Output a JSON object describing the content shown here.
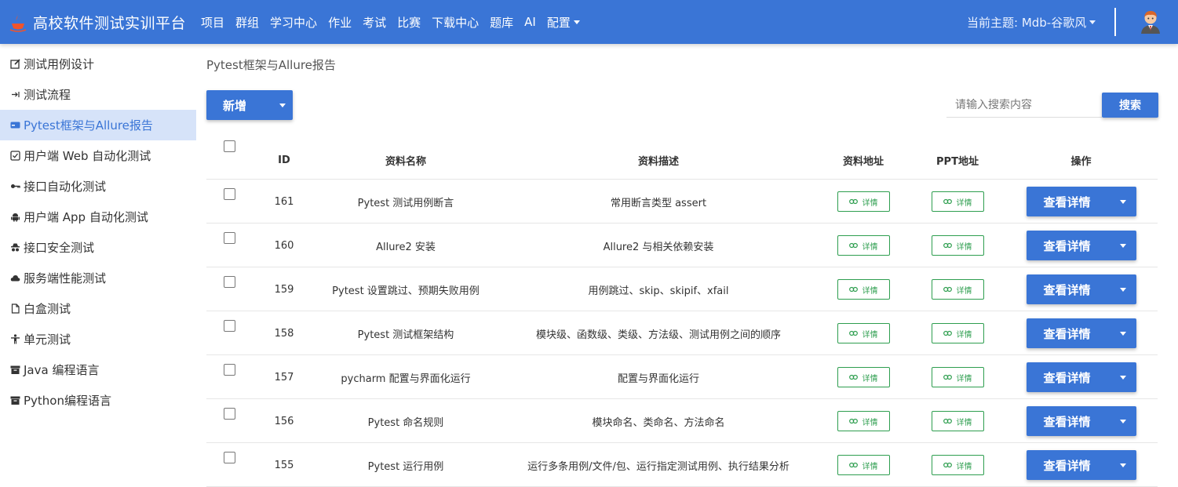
{
  "navbar": {
    "brand": "高校软件测试实训平台",
    "links": [
      "项目",
      "群组",
      "学习中心",
      "作业",
      "考试",
      "比赛",
      "下载中心",
      "题库",
      "AI",
      "配置"
    ],
    "theme": "当前主题: Mdb-谷歌风",
    "brand_color": "#3a75d6"
  },
  "sidebar": {
    "items": [
      {
        "label": "测试用例设计",
        "icon": "edit-icon"
      },
      {
        "label": "测试流程",
        "icon": "arrow-right-icon"
      },
      {
        "label": "Pytest框架与Allure报告",
        "icon": "card-icon"
      },
      {
        "label": "用户端 Web 自动化测试",
        "icon": "checkbox-icon"
      },
      {
        "label": "接口自动化测试",
        "icon": "key-icon"
      },
      {
        "label": "用户端 App 自动化测试",
        "icon": "android-icon"
      },
      {
        "label": "接口安全测试",
        "icon": "spy-icon"
      },
      {
        "label": "服务端性能测试",
        "icon": "cloud-icon"
      },
      {
        "label": "白盒测试",
        "icon": "file-icon"
      },
      {
        "label": "单元测试",
        "icon": "person-icon"
      },
      {
        "label": "Java 编程语言",
        "icon": "archive-icon"
      },
      {
        "label": "Python编程语言",
        "icon": "archive-icon"
      }
    ],
    "active_index": 2
  },
  "main": {
    "breadcrumb": "Pytest框架与Allure报告",
    "add_label": "新增",
    "search_placeholder": "请输入搜索内容",
    "search_label": "搜索"
  },
  "table": {
    "headers": {
      "id": "ID",
      "name": "资料名称",
      "desc": "资料描述",
      "url": "资料地址",
      "ppt": "PPT地址",
      "op": "操作"
    },
    "detail_label": "详情",
    "view_label": "查看详情",
    "rows": [
      {
        "id": "161",
        "name": "Pytest 测试用例断言",
        "desc": "常用断言类型 assert"
      },
      {
        "id": "160",
        "name": "Allure2 安装",
        "desc": "Allure2 与相关依赖安装"
      },
      {
        "id": "159",
        "name": "Pytest 设置跳过、预期失败用例",
        "desc": "用例跳过、skip、skipif、xfail"
      },
      {
        "id": "158",
        "name": "Pytest 测试框架结构",
        "desc": "模块级、函数级、类级、方法级、测试用例之间的顺序"
      },
      {
        "id": "157",
        "name": "pycharm 配置与界面化运行",
        "desc": "配置与界面化运行"
      },
      {
        "id": "156",
        "name": "Pytest 命名规则",
        "desc": "模块命名、类命名、方法命名"
      },
      {
        "id": "155",
        "name": "Pytest 运行用例",
        "desc": "运行多条用例/文件/包、运行指定测试用例、执行结果分析"
      }
    ]
  }
}
